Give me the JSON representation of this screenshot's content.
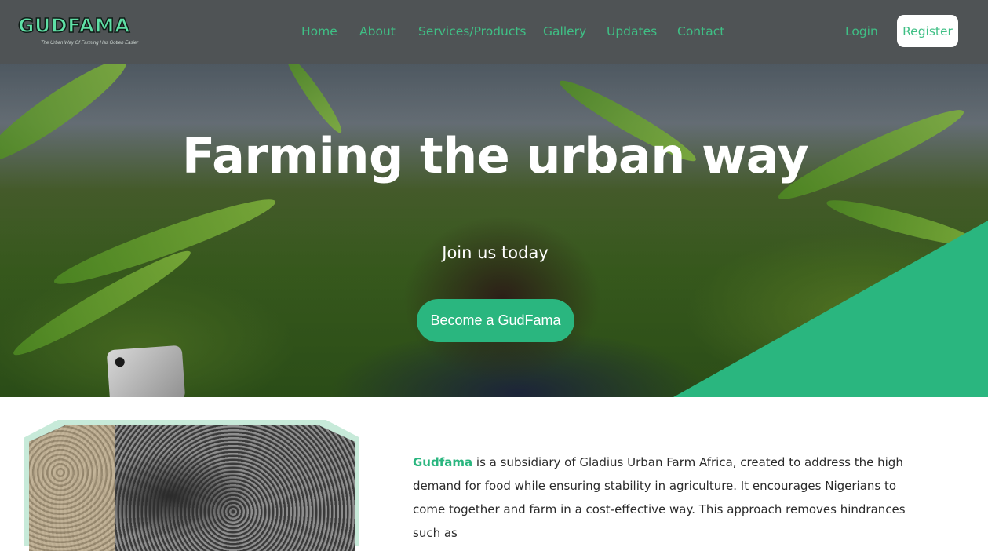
{
  "brand": {
    "logo": "GUDFAMA",
    "tagline": "The Urban Way Of Farming Has Gotten Easier"
  },
  "nav": {
    "links": [
      "Home",
      "About",
      "Services/Products",
      "Gallery",
      "Updates",
      "Contact"
    ],
    "login": "Login",
    "register": "Register"
  },
  "hero": {
    "title": "Farming the urban way",
    "subtitle": "Join us today",
    "cta": "Become a GudFama"
  },
  "about": {
    "brand_word": "Gudfama",
    "text": " is a subsidiary of Gladius Urban Farm Africa, created to address the high demand for food while ensuring stability in agriculture. It encourages Nigerians to come together and farm in a cost-effective way. This approach removes hindrances such as"
  },
  "colors": {
    "accent": "#2ab67f",
    "nav_bg": "#4f5355",
    "nav_text": "#3fbf85"
  }
}
